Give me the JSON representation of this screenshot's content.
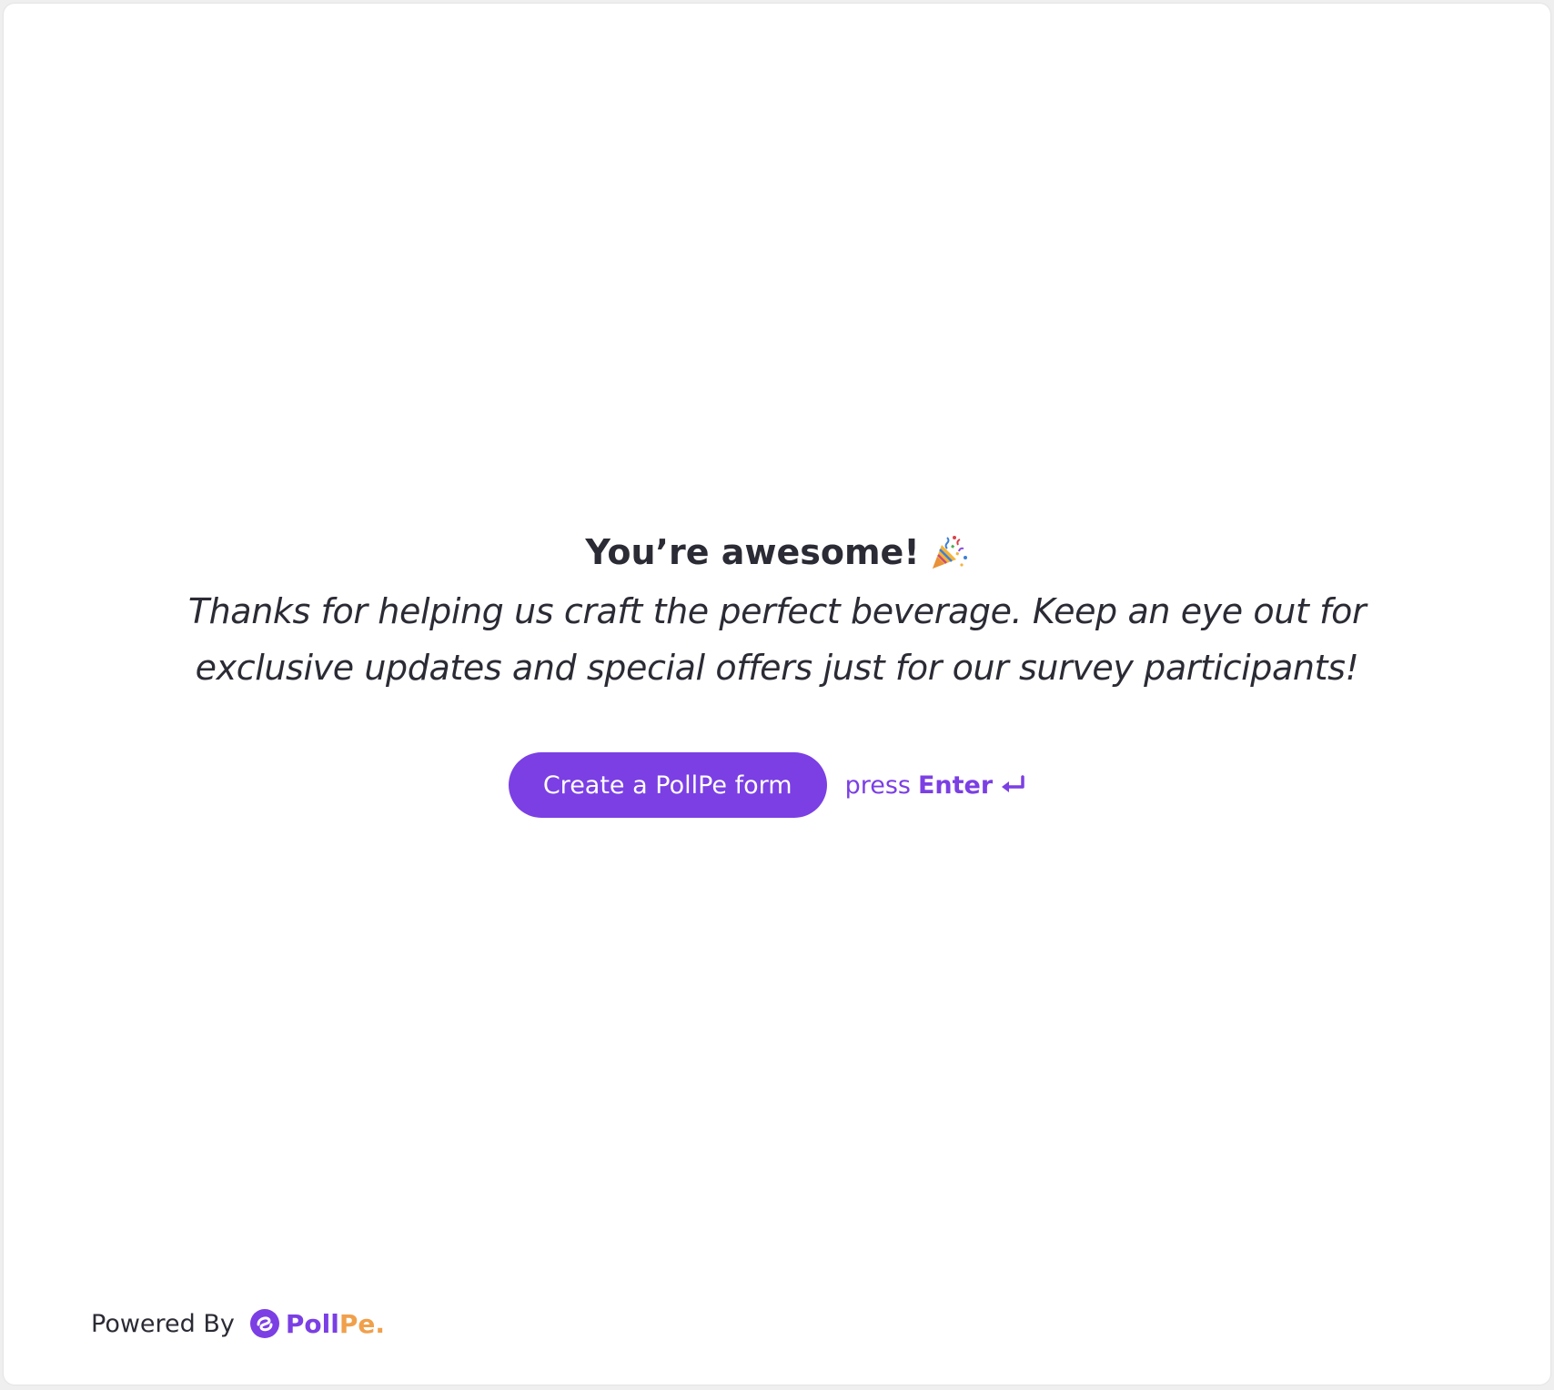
{
  "completion": {
    "heading": "You’re awesome!",
    "heading_icon": "party-popper-icon",
    "message": "Thanks for helping us craft the perfect beverage. Keep an eye out for exclusive updates and special offers just for our survey participants!"
  },
  "actions": {
    "cta_label": "Create a PollPe form",
    "hint_prefix": "press",
    "hint_key": "Enter",
    "hint_icon": "enter-key-icon"
  },
  "footer": {
    "powered_by": "Powered By",
    "brand_part1": "Poll",
    "brand_part2": "Pe."
  },
  "colors": {
    "accent": "#7b3fe4",
    "brand_secondary": "#f0a04b",
    "text": "#2b2b35",
    "background": "#efefef",
    "card": "#ffffff"
  }
}
